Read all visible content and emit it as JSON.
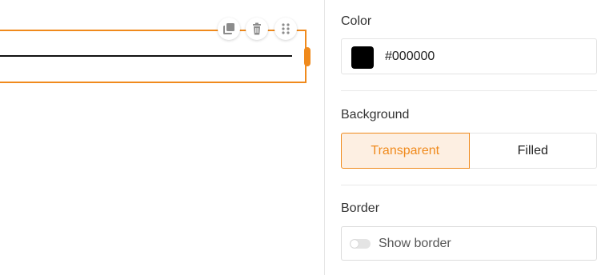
{
  "canvas": {
    "line_color": "#111111",
    "selection_color": "#f08a1c",
    "toolbar": {
      "duplicate_icon": "copy-icon",
      "delete_icon": "trash-icon",
      "drag_icon": "drag-handle-icon"
    }
  },
  "panel": {
    "color": {
      "label": "Color",
      "value": "#000000",
      "swatch": "#000000"
    },
    "background": {
      "label": "Background",
      "options": [
        "Transparent",
        "Filled"
      ],
      "selected": "Transparent"
    },
    "border": {
      "label": "Border",
      "toggle_label": "Show border",
      "enabled": false
    }
  },
  "theme": {
    "accent": "#f08a1c",
    "accent_bg": "#fdefe2"
  }
}
